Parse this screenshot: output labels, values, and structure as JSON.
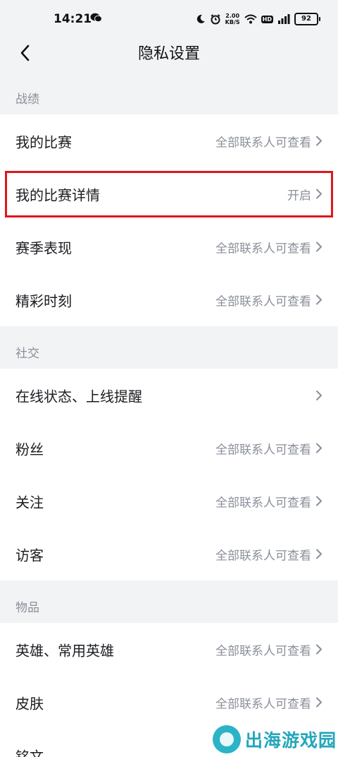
{
  "status_bar": {
    "time": "14:21",
    "network_speed_value": "2.00",
    "network_speed_unit": "KB/S",
    "hd_badge": "HD",
    "battery": "92"
  },
  "nav": {
    "title": "隐私设置"
  },
  "sections": [
    {
      "header": "战绩",
      "rows": [
        {
          "label": "我的比赛",
          "value": "全部联系人可查看"
        },
        {
          "label": "我的比赛详情",
          "value": "开启"
        },
        {
          "label": "赛季表现",
          "value": "全部联系人可查看"
        },
        {
          "label": "精彩时刻",
          "value": "全部联系人可查看"
        }
      ]
    },
    {
      "header": "社交",
      "rows": [
        {
          "label": "在线状态、上线提醒",
          "value": ""
        },
        {
          "label": "粉丝",
          "value": "全部联系人可查看"
        },
        {
          "label": "关注",
          "value": "全部联系人可查看"
        },
        {
          "label": "访客",
          "value": "全部联系人可查看"
        }
      ]
    },
    {
      "header": "物品",
      "rows": [
        {
          "label": "英雄、常用英雄",
          "value": "全部联系人可查看"
        },
        {
          "label": "皮肤",
          "value": "全部联系人可查看"
        },
        {
          "label": "铭文",
          "value": ""
        }
      ]
    }
  ],
  "watermark": {
    "text": "出海游戏园"
  },
  "icons": {
    "back": "back-arrow-icon",
    "chevron": "chevron-right-icon",
    "wechat": "wechat-icon",
    "moon": "moon-icon",
    "alarm": "alarm-icon",
    "wifi": "wifi-icon",
    "signal": "signal-icon"
  },
  "colors": {
    "page_background": "#f2f3f5",
    "card_background": "#ffffff",
    "highlight_border": "#e0161b",
    "secondary_text": "#8a8f99",
    "watermark": "#25a6bb"
  }
}
